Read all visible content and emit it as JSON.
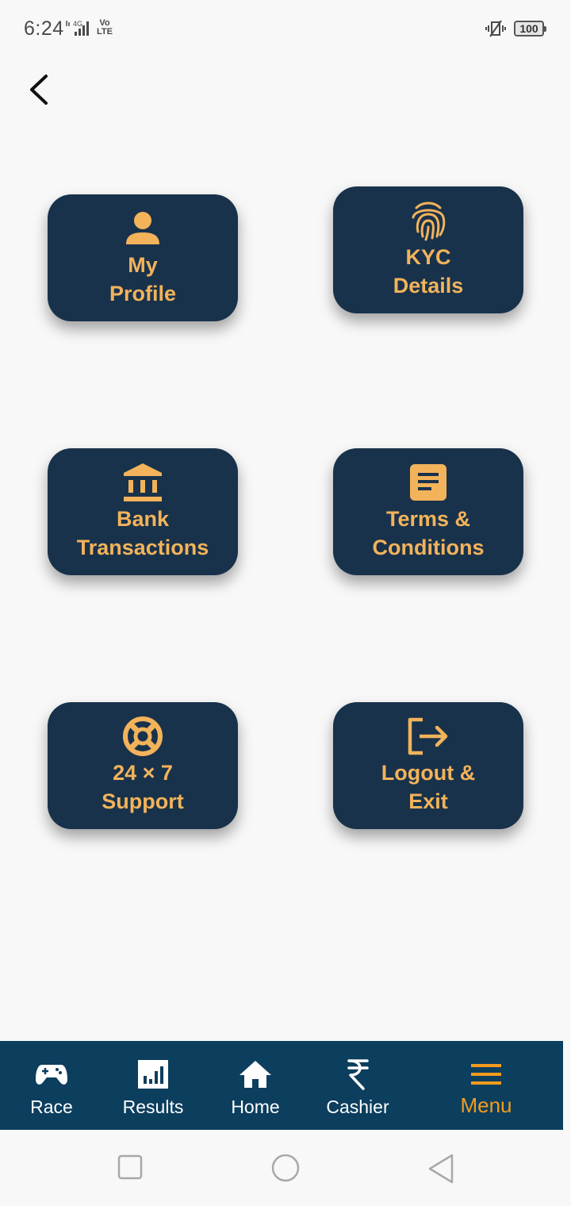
{
  "status_bar": {
    "time": "6:24",
    "network": "4G",
    "volte_top": "Vo",
    "volte_bottom": "LTE",
    "battery": "100"
  },
  "colors": {
    "tile_bg": "#19324b",
    "tile_text": "#f2b35b",
    "nav_bg": "#0c3e5e",
    "nav_active": "#f39c1d"
  },
  "menu": {
    "tiles": [
      {
        "icon": "user-icon",
        "line1": "My",
        "line2": "Profile"
      },
      {
        "icon": "fingerprint-icon",
        "line1": "KYC",
        "line2": "Details"
      },
      {
        "icon": "bank-icon",
        "line1": "Bank",
        "line2": "Transactions"
      },
      {
        "icon": "document-icon",
        "line1": "Terms &",
        "line2": "Conditions"
      },
      {
        "icon": "lifebuoy-icon",
        "line1": "24 × 7",
        "line2": "Support"
      },
      {
        "icon": "logout-icon",
        "line1": "Logout &",
        "line2": "Exit"
      }
    ]
  },
  "bottom_nav": {
    "items": [
      {
        "icon": "gamepad-icon",
        "label": "Race"
      },
      {
        "icon": "bar-chart-icon",
        "label": "Results"
      },
      {
        "icon": "home-icon",
        "label": "Home"
      },
      {
        "icon": "rupee-icon",
        "label": "Cashier"
      },
      {
        "icon": "menu-icon",
        "label": "Menu",
        "active": true
      }
    ]
  }
}
